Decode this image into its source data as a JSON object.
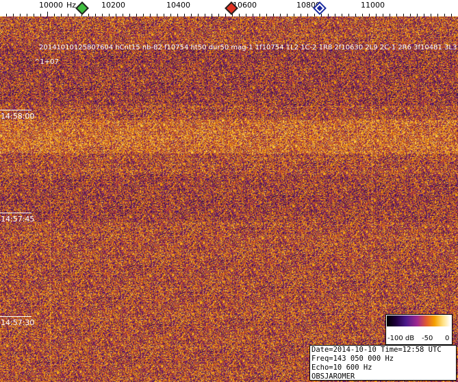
{
  "ruler": {
    "unit": "Hz",
    "labels": [
      "10000",
      "10200",
      "10400",
      "10600",
      "10800",
      "11000"
    ],
    "markers": [
      "green-marker-icon",
      "red-marker-icon",
      "blue-marker-icon"
    ]
  },
  "waterfall": {
    "detection_text": "20141010125807604 hCnt15 nb-82 f10754 ht50 dur50 mag-1 1f10754 1L2 1C-2 1R8 2f10630 2L9 2C-1 2R6 3f10481 3L3 3C2",
    "sub_text": "^1+07",
    "time_labels": [
      "14:58:00",
      "14:57:45",
      "14:57:30"
    ]
  },
  "colorbar": {
    "labels": [
      "-100 dB",
      "-50",
      "0"
    ]
  },
  "info": {
    "line1": "Date=2014-10-10 Time=12:58 UTC",
    "line2": "Freq=143 050 000 Hz",
    "line3": "Echo=10 600 Hz",
    "line4": "OBSJAROMER"
  },
  "colors": {
    "waterfall_dark": "#3a1560",
    "waterfall_mid": "#b0402a",
    "waterfall_bright": "#f0a000"
  }
}
